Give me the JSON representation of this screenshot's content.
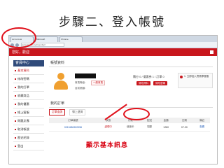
{
  "title": "步驟二、登入帳號",
  "browser": {
    "tabs": [
      "vtc.com.tw",
      "Microsoft",
      "Chrome"
    ],
    "url": "www.vtc.com.tw/member/"
  },
  "header": {
    "greeting": "您好，歡迎"
  },
  "sidebar": {
    "heading": "會員中心",
    "items": [
      "基本資料",
      "修改密碼",
      "我的訂單",
      "收藏商品",
      "我的優惠",
      "線上客服",
      "問題反應",
      "取消帳號",
      "歷史紀錄",
      "登出"
    ]
  },
  "profile": {
    "section_title": "帳號資料",
    "member_level_label": "會員等級：",
    "member_level_value": "一般會員",
    "balance_label": "目前餘額：",
    "stats": "積分 0 / 優惠券 1 / 訂單 0",
    "button_1": "修改資料",
    "button_2": "修改密碼",
    "promo_text": "1. 立即加入會員享優惠"
  },
  "orders": {
    "section_title": "我的訂單",
    "subtabs": [
      "訂單查詢",
      "線上退貨"
    ],
    "columns": [
      "訂單編號",
      "狀態",
      "付款",
      "配送",
      "金額",
      "日期",
      "備註"
    ],
    "rows": [
      [
        "0019480620056",
        "處理中",
        "信用卡",
        "宅配",
        "1280",
        "07-30",
        "查看"
      ]
    ]
  },
  "annotation": "顯示基本訊息",
  "colors": {
    "brand_red": "#c8161d",
    "annotation_red": "#d80010",
    "sidebar_head": "#2f4a7a"
  }
}
